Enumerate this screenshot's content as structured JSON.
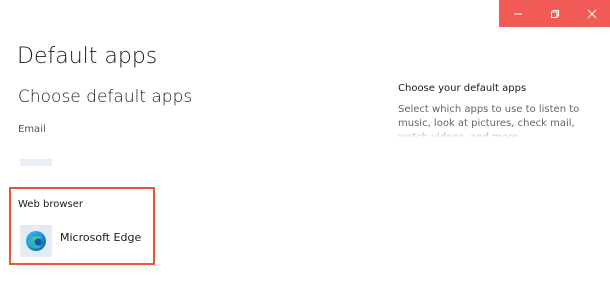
{
  "window": {
    "controls": {
      "minimize": "–",
      "restore": "❐",
      "close": "✕",
      "bar_color": "#f15b55"
    }
  },
  "page": {
    "title": "Default apps",
    "section_title": "Choose default apps"
  },
  "email": {
    "label": "Email"
  },
  "web_browser": {
    "label": "Web browser",
    "app_name": "Microsoft Edge",
    "icon": "microsoft-edge-icon",
    "highlight_color": "#e8573a"
  },
  "sidebar": {
    "title": "Choose your default apps",
    "description": "Select which apps to use to listen to music, look at pictures, check mail, watch videos, and more."
  }
}
